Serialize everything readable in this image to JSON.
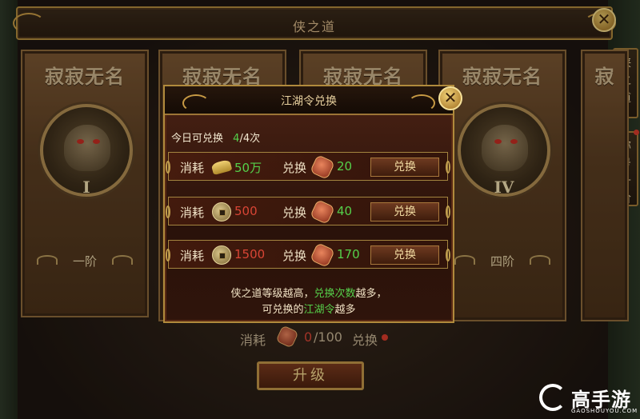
{
  "window": {
    "title": "侠之道"
  },
  "side_tabs": [
    {
      "label": [
        "侠",
        "之",
        "道"
      ]
    },
    {
      "label": [
        "称",
        "号",
        "升",
        "阶"
      ]
    }
  ],
  "cards": [
    {
      "name": "寂寂无名",
      "rank": "I",
      "tier": "一阶"
    },
    {
      "name": "寂寂无名",
      "rank": "",
      "tier": ""
    },
    {
      "name": "寂寂无名",
      "rank": "",
      "tier": ""
    },
    {
      "name": "寂寂无名",
      "rank": "IV",
      "tier": "四阶"
    },
    {
      "name": "寂",
      "rank": "",
      "tier": ""
    }
  ],
  "progress": {
    "label": "消耗",
    "current": "0",
    "total": "/100",
    "button": "兑换"
  },
  "upgrade_button": "升级",
  "modal": {
    "title": "江湖令兑换",
    "today_label": "今日可兑换",
    "today_count": "4",
    "today_total": "/4次",
    "rows": [
      {
        "cost_label": "消耗",
        "cost_icon": "gold-ingot-icon",
        "cost_amount": "50万",
        "cost_color": "#55d04a",
        "get_label": "兑换",
        "get_icon": "jianghu-token-icon",
        "get_amount": "20",
        "button": "兑换"
      },
      {
        "cost_label": "消耗",
        "cost_icon": "coin-icon",
        "cost_amount": "500",
        "cost_color": "#d84535",
        "get_label": "兑换",
        "get_icon": "jianghu-token-icon",
        "get_amount": "40",
        "button": "兑换"
      },
      {
        "cost_label": "消耗",
        "cost_icon": "coin-icon",
        "cost_amount": "1500",
        "cost_color": "#d84535",
        "get_label": "兑换",
        "get_icon": "jianghu-token-icon",
        "get_amount": "170",
        "button": "兑换"
      }
    ],
    "note_line1_a": "侠之道等级越高，",
    "note_line1_b": "兑换次数",
    "note_line1_c": "越多，",
    "note_line2_a": "可兑换的",
    "note_line2_b": "江湖令",
    "note_line2_c": "越多"
  },
  "watermark": {
    "text": "高手游",
    "sub": "GAOSHOUYOU.COM"
  }
}
